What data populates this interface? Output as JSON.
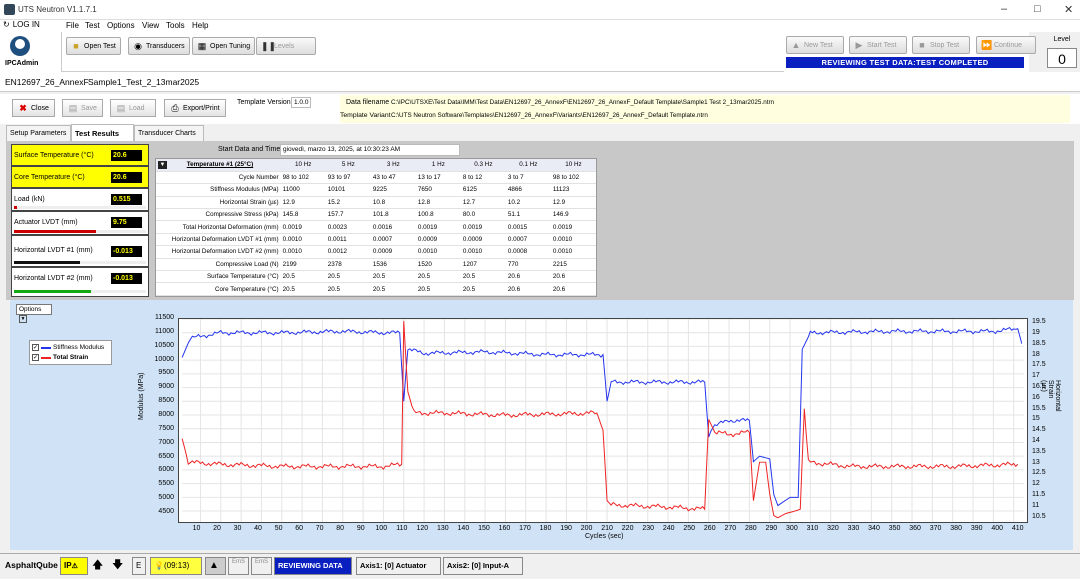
{
  "window": {
    "title": "UTS Neutron  V1.1.7.1"
  },
  "menu": {
    "login": "LOG IN",
    "items": [
      "File",
      "Test",
      "Options",
      "View",
      "Tools",
      "Help"
    ]
  },
  "user": {
    "name": "IPCAdmin"
  },
  "toolbar": {
    "new_test": "Open Test",
    "transducers": "Transducers",
    "open_tuning": "Open Tuning",
    "levels": "Levels"
  },
  "test_controls": {
    "new_test": "New Test",
    "start_test": "Start Test",
    "stop_test": "Stop Test",
    "continue": "Continue",
    "status": "REVIEWING TEST DATA:TEST COMPLETED"
  },
  "level": {
    "label": "Level",
    "value": "0"
  },
  "doc_tabs": [
    "EN12697_26_AnnexF",
    "Sample1_Test_2_13mar2025"
  ],
  "actions": {
    "close": "Close",
    "save": "Save",
    "load": "Load",
    "export": "Export/Print",
    "template_version_label": "Template Version",
    "template_version": "1.0.0"
  },
  "info": {
    "data_filename_label": "Data filename",
    "data_filename": "C:\\IPC\\UTSXE\\Test Data\\IMM\\Test Data\\EN12697_26_AnnexF\\EN12697_26_AnnexF_Default Template\\Sample1 Test 2_13mar2025.ntrn",
    "template_variant_label": "Template Variant",
    "template_variant": "C:\\UTS Neutron Software\\Templates\\EN12697_26_AnnexF\\Variants\\EN12697_26_AnnexF_Default Template.ntrn"
  },
  "subtabs": [
    "Setup Parameters",
    "Test Results",
    "Transducer Charts"
  ],
  "gauges": [
    {
      "name": "Surface Temperature (°C)",
      "value": "20.6"
    },
    {
      "name": "Core Temperature (°C)",
      "value": "20.6"
    },
    {
      "name": "Load (kN)",
      "value": "0.515",
      "fill": 0.02
    },
    {
      "name": "Actuator LVDT (mm)",
      "value": "9.75",
      "fill": 0.62
    },
    {
      "name": "Horizontal LVDT #1 (mm)",
      "value": "-0.013",
      "fill": 0.5
    },
    {
      "name": "Horizontal LVDT #2 (mm)",
      "value": "-0.013",
      "fill": 0.58
    }
  ],
  "start": {
    "label": "Start Data and Time",
    "value": "giovedì, marzo 13, 2025, at 10:30:23 AM"
  },
  "results": {
    "header": "Temperature #1 (25°C)",
    "columns": [
      "10 Hz",
      "5 Hz",
      "3 Hz",
      "1 Hz",
      "0.3 Hz",
      "0.1 Hz",
      "10 Hz"
    ],
    "rows": [
      {
        "label": "Cycle Number",
        "values": [
          "98 to 102",
          "93 to 97",
          "43 to 47",
          "13 to 17",
          "8 to 12",
          "3 to 7",
          "98 to 102"
        ]
      },
      {
        "label": "Stiffness Modulus (MPa)",
        "values": [
          "11000",
          "10101",
          "9225",
          "7650",
          "6125",
          "4866",
          "11123"
        ]
      },
      {
        "label": "Horizontal Strain (µε)",
        "values": [
          "12.9",
          "15.2",
          "10.8",
          "12.8",
          "12.7",
          "10.2",
          "12.9"
        ]
      },
      {
        "label": "Compressive Stress (kPa)",
        "values": [
          "145.8",
          "157.7",
          "101.8",
          "100.8",
          "80.0",
          "51.1",
          "146.9"
        ]
      },
      {
        "label": "Total Horizontal Deformation (mm)",
        "values": [
          "0.0019",
          "0.0023",
          "0.0016",
          "0.0019",
          "0.0019",
          "0.0015",
          "0.0019"
        ]
      },
      {
        "label": "Horizontal Deformation LVDT #1 (mm)",
        "values": [
          "0.0010",
          "0.0011",
          "0.0007",
          "0.0009",
          "0.0009",
          "0.0007",
          "0.0010"
        ]
      },
      {
        "label": "Horizontal Deformation LVDT #2 (mm)",
        "values": [
          "0.0010",
          "0.0012",
          "0.0009",
          "0.0010",
          "0.0010",
          "0.0008",
          "0.0010"
        ]
      },
      {
        "label": "Compressive Load (N)",
        "values": [
          "2199",
          "2378",
          "1536",
          "1520",
          "1207",
          "770",
          "2215"
        ]
      },
      {
        "label": "Surface Temperature (°C)",
        "values": [
          "20.5",
          "20.5",
          "20.5",
          "20.5",
          "20.5",
          "20.6",
          "20.6"
        ]
      },
      {
        "label": "Core Temperature (°C)",
        "values": [
          "20.5",
          "20.5",
          "20.5",
          "20.5",
          "20.5",
          "20.6",
          "20.6"
        ]
      }
    ]
  },
  "chart_options": "Options",
  "chart_data": {
    "type": "line",
    "xlabel": "Cycles (sec)",
    "ylabel": "Modulus (MPa)",
    "y2label": "Horizontal Strain (µε)",
    "xlim": [
      1,
      415
    ],
    "ylim": [
      4100,
      11500
    ],
    "y2lim": [
      10.2,
      19.7
    ],
    "xticks": [
      10,
      20,
      30,
      40,
      50,
      60,
      70,
      80,
      90,
      100,
      110,
      120,
      130,
      140,
      150,
      160,
      170,
      180,
      190,
      200,
      210,
      220,
      230,
      240,
      250,
      260,
      270,
      280,
      290,
      300,
      310,
      320,
      330,
      340,
      350,
      360,
      370,
      380,
      390,
      400,
      410
    ],
    "yticks": [
      4500,
      5000,
      5500,
      6000,
      6500,
      7000,
      7500,
      8000,
      8500,
      9000,
      9500,
      10000,
      10500,
      11000,
      11500
    ],
    "y2ticks": [
      10.5,
      11,
      11.5,
      12,
      12.5,
      13,
      13.5,
      14,
      14.5,
      15,
      15.5,
      16,
      16.5,
      17,
      17.5,
      18,
      18.5,
      19,
      19.5
    ],
    "grid": true,
    "legend_position": "top-left",
    "series": [
      {
        "name": "Stiffness Modulus",
        "color": "#2233ee",
        "axis": "left",
        "points": [
          [
            1,
            10100
          ],
          [
            5,
            10800
          ],
          [
            20,
            11000
          ],
          [
            50,
            11000
          ],
          [
            80,
            11050
          ],
          [
            100,
            11000
          ],
          [
            108,
            11000
          ],
          [
            110,
            8500
          ],
          [
            112,
            10400
          ],
          [
            120,
            10250
          ],
          [
            150,
            10300
          ],
          [
            180,
            10200
          ],
          [
            208,
            10200
          ],
          [
            210,
            8500
          ],
          [
            212,
            9200
          ],
          [
            240,
            9200
          ],
          [
            258,
            9200
          ],
          [
            260,
            7200
          ],
          [
            262,
            7600
          ],
          [
            270,
            7800
          ],
          [
            280,
            7800
          ],
          [
            282,
            6300
          ],
          [
            285,
            6500
          ],
          [
            290,
            6400
          ],
          [
            292,
            5100
          ],
          [
            294,
            4700
          ],
          [
            296,
            4800
          ],
          [
            298,
            4900
          ],
          [
            300,
            5000
          ],
          [
            304,
            5000
          ],
          [
            306,
            10400
          ],
          [
            310,
            11000
          ],
          [
            350,
            11050
          ],
          [
            400,
            11050
          ],
          [
            412,
            11150
          ],
          [
            414,
            10600
          ]
        ]
      },
      {
        "name": "Total Strain",
        "color": "#ee2222",
        "axis": "right",
        "points": [
          [
            1,
            14.1
          ],
          [
            4,
            13.0
          ],
          [
            20,
            12.9
          ],
          [
            50,
            12.8
          ],
          [
            80,
            12.8
          ],
          [
            100,
            12.8
          ],
          [
            109,
            12.9
          ],
          [
            110,
            19.6
          ],
          [
            112,
            16.3
          ],
          [
            115,
            15.3
          ],
          [
            130,
            15.3
          ],
          [
            160,
            15.2
          ],
          [
            205,
            15.3
          ],
          [
            208,
            14.5
          ],
          [
            210,
            11.2
          ],
          [
            212,
            11.0
          ],
          [
            240,
            10.9
          ],
          [
            258,
            10.8
          ],
          [
            260,
            15.0
          ],
          [
            263,
            14.4
          ],
          [
            270,
            14.3
          ],
          [
            280,
            14.4
          ],
          [
            282,
            11.2
          ],
          [
            285,
            13.0
          ],
          [
            288,
            13.0
          ],
          [
            290,
            11.5
          ],
          [
            292,
            10.5
          ],
          [
            294,
            10.4
          ],
          [
            298,
            10.6
          ],
          [
            302,
            10.7
          ],
          [
            305,
            10.8
          ],
          [
            307,
            15.5
          ],
          [
            309,
            13.0
          ],
          [
            330,
            12.8
          ],
          [
            380,
            12.8
          ],
          [
            412,
            12.9
          ]
        ]
      }
    ]
  },
  "statusbar": {
    "app": "AsphaltQube",
    "ip": "IP",
    "time": "(09:13)",
    "em1": "EmS",
    "em2": "EmS",
    "reviewing": "REVIEWING DATA",
    "axis1": "Axis1: [0] Actuator",
    "axis2": "Axis2: [0] Input-A",
    "e": "E"
  }
}
